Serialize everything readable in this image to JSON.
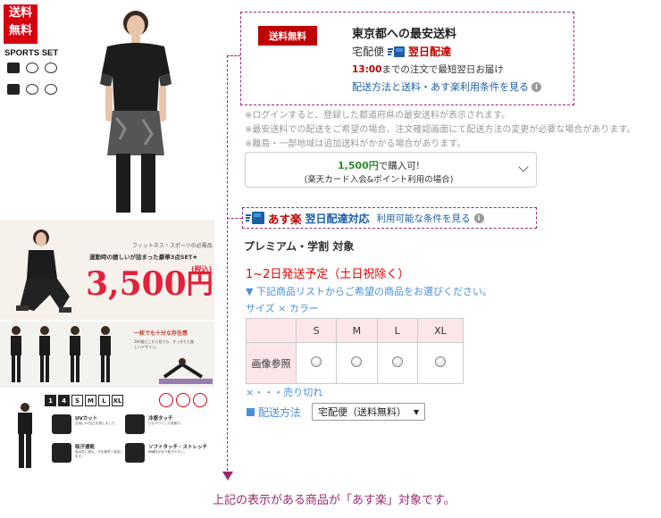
{
  "banner": {
    "free_badge_lines": [
      "送料",
      "無料"
    ],
    "sports_set": "SPORTS SET",
    "catch_small": "フィットネス・スポーツの必需品",
    "catch_main": "運動時の嬉しいが詰まった豪華3点SET★",
    "price_number": "3,500",
    "price_yen": "円!",
    "price_tax": "(税込)",
    "panel3_heading": "一枚でも十分な存在感",
    "panel3_sub": "360度どこから見ても、すっきりと美しいデザイン。",
    "sizes": [
      "1",
      "4",
      "S",
      "M",
      "L",
      "XL"
    ],
    "features": [
      {
        "title": "UVカット",
        "desc": "生地にUV加工を施しました。"
      },
      {
        "title": "冷感タッチ",
        "desc": "ひんやりとした肌触り。"
      },
      {
        "title": "吸汗速乾",
        "desc": "吸水性に優れ、汗を素早く吸収します。"
      },
      {
        "title": "ソフトタッチ・ストレッチ",
        "desc": "伸縮性があり動きやすい。"
      }
    ]
  },
  "shipping": {
    "free_badge": "送料無料",
    "title": "東京都への最安送料",
    "method": "宅配便",
    "next_day": "翌日配達",
    "deadline_time": "13:00",
    "deadline_rest": "までの注文で最短翌日お届け",
    "link": "配送方法と送料・あす楽利用条件を見る"
  },
  "notes": [
    "※ログインすると、登録した都道府県の最安送料が表示されます。",
    "※最安送料での配送をご希望の場合、注文確認画面にて配送方法の変更が必要な場合があります。",
    "※離島・一部地域は追加送料がかかる場合があります。"
  ],
  "points": {
    "amount": "1,500円",
    "suffix": "で購入可!",
    "condition": "(楽天カード入会&ポイント利用の場合)"
  },
  "asuraku": {
    "title": "あす楽",
    "next_day": "翌日配達対応",
    "link": "利用可能な条件を見る"
  },
  "product": {
    "premium": "プレミアム・学割 対象",
    "schedule": "1~2日発送予定（土日祝除く）",
    "choose_note": "▼ 下記商品リストからご希望の商品をお選びください。",
    "size_color": "サイズ × カラー",
    "table_sizes": [
      "S",
      "M",
      "L",
      "XL"
    ],
    "row_label": "画像参照",
    "soldout": "×・・・売り切れ",
    "ship_method_label": "配送方法",
    "ship_method_value": "宅配便（送料無料）",
    "caret": "▼"
  },
  "bottom_message": "上記の表示がある商品が「あす楽」対象です。",
  "colors": {
    "rakuten_red": "#bf0000",
    "link_blue": "#1d5fa6",
    "guide_purple": "#9b2a6e",
    "table_pink": "#fde6ea"
  }
}
